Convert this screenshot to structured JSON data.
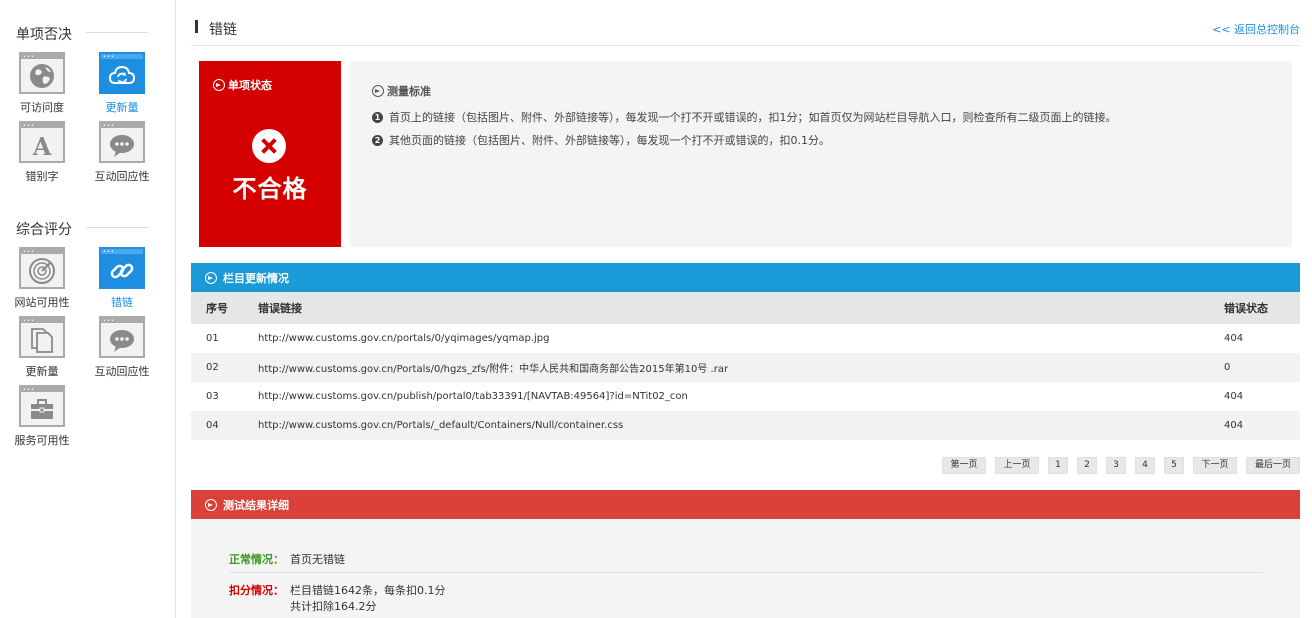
{
  "sidebar": {
    "section1": {
      "title": "单项否决",
      "items": [
        {
          "label": "可访问度",
          "icon": "globe-icon"
        },
        {
          "label": "更新量",
          "icon": "cloud-refresh-icon"
        },
        {
          "label": "错别字",
          "icon": "letter-a-icon"
        },
        {
          "label": "互动回应性",
          "icon": "chat-bubble-icon"
        }
      ]
    },
    "section2": {
      "title": "综合评分",
      "items": [
        {
          "label": "网站可用性",
          "icon": "radar-icon"
        },
        {
          "label": "错链",
          "icon": "link-icon"
        },
        {
          "label": "更新量",
          "icon": "documents-icon"
        },
        {
          "label": "互动回应性",
          "icon": "chat-bubble-icon"
        },
        {
          "label": "服务可用性",
          "icon": "briefcase-icon"
        }
      ]
    }
  },
  "header": {
    "title": "错链",
    "back_link": "<< 返回总控制台"
  },
  "status": {
    "heading": "单项状态",
    "verdict": "不合格",
    "color": "#d40000"
  },
  "criteria": {
    "heading": "测量标准",
    "rules": [
      {
        "num": "1",
        "text": "首页上的链接（包括图片、附件、外部链接等），每发现一个打不开或错误的，扣1分；如首页仅为网站栏目导航入口，则检查所有二级页面上的链接。"
      },
      {
        "num": "2",
        "text": "其他页面的链接（包括图片、附件、外部链接等），每发现一个打不开或错误的，扣0.1分。"
      }
    ]
  },
  "column_section": {
    "title": "栏目更新情况",
    "color": "#1a9bd7",
    "headers": {
      "index": "序号",
      "link": "错误链接",
      "status": "错误状态"
    },
    "rows": [
      {
        "index": "01",
        "link": "http://www.customs.gov.cn/portals/0/yqimages/yqmap.jpg",
        "status": "404"
      },
      {
        "index": "02",
        "link": "http://www.customs.gov.cn/Portals/0/hgzs_zfs/附件：中华人民共和国商务部公告2015年第10号 .rar",
        "status": "0"
      },
      {
        "index": "03",
        "link": "http://www.customs.gov.cn/publish/portal0/tab33391/[NAVTAB:49564]?id=NTit02_con",
        "status": "404"
      },
      {
        "index": "04",
        "link": "http://www.customs.gov.cn/Portals/_default/Containers/Null/container.css",
        "status": "404"
      }
    ]
  },
  "pager": {
    "first": "第一页",
    "prev": "上一页",
    "pages": [
      "1",
      "2",
      "3",
      "4",
      "5"
    ],
    "next": "下一页",
    "last": "最后一页"
  },
  "detail_section": {
    "title": "测试结果详细",
    "color": "#d9413a",
    "normal": {
      "label": "正常情况：",
      "value": "首页无错链",
      "color": "#3a9a1c"
    },
    "deduct": {
      "label": "扣分情况：",
      "value_line1": "栏目错链1642条，每条扣0.1分",
      "value_line2": "共计扣除164.2分",
      "color": "#d40000"
    }
  }
}
